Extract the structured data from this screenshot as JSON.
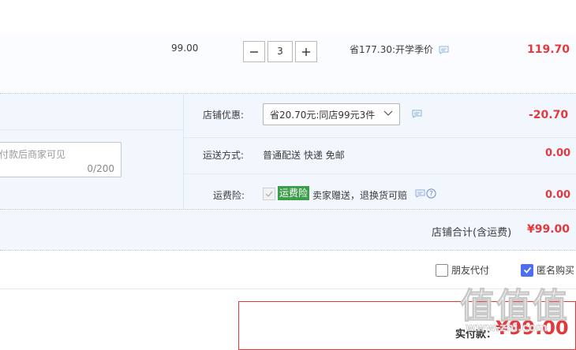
{
  "item": {
    "price": "99.00",
    "quantity": "3",
    "promo_text": "省177.30:开学季价",
    "subtotal": "119.70"
  },
  "shop": {
    "message_placeholder": "付款后商家可见",
    "message_counter": "0/200",
    "discount": {
      "label": "店铺优惠:",
      "selected": "省20.70元:同店99元3件",
      "amount": "-20.70"
    },
    "shipping": {
      "label": "运送方式:",
      "value": "普通配送 快递 免邮",
      "amount": "0.00"
    },
    "insurance": {
      "label": "运费险:",
      "badge": "运费险",
      "text": "卖家赠送，退换货可赔",
      "amount": "0.00"
    },
    "total_label": "店铺合计(含运费)",
    "total_amount": "¥99.00"
  },
  "options": {
    "friend_pay": {
      "label": "朋友代付",
      "checked": false
    },
    "anonymous": {
      "label": "匿名购买",
      "checked": true
    }
  },
  "payment": {
    "label": "实付款：",
    "amount": "¥99.00"
  },
  "watermark": {
    "text": "值值值",
    "url": "www.zhi.com"
  },
  "colors": {
    "accent_red": "#e4393c",
    "panel_bg": "#f2f6fd",
    "badge_green": "#3c9d4a",
    "check_blue": "#4c6ef5"
  },
  "icons": [
    "minus-icon",
    "plus-icon",
    "chat-icon",
    "chevron-down-icon",
    "check-icon",
    "help-icon"
  ]
}
